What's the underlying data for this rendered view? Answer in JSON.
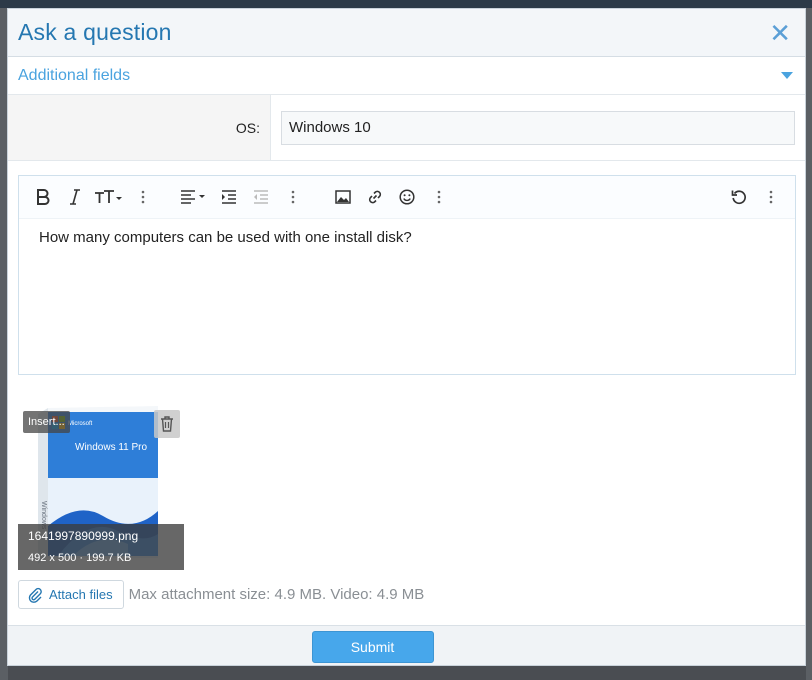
{
  "modal": {
    "title": "Ask a question",
    "close_glyph": "✕"
  },
  "additional_fields": {
    "title": "Additional fields"
  },
  "os_field": {
    "label": "OS:",
    "value": "Windows 10"
  },
  "editor": {
    "toolbar": [
      "bold-icon",
      "italic-icon",
      "text-size-icon",
      "more-icon",
      "align-icon",
      "indent-icon",
      "outdent-icon",
      "more-icon",
      "image-icon",
      "link-icon",
      "emoji-icon",
      "more-icon",
      "undo-icon",
      "more-icon"
    ],
    "content": "How many computers can be used with one install disk?"
  },
  "attachment": {
    "insert_label": "Insert...",
    "filename": "1641997890999.png",
    "meta": "492 x 500 · 199.7 KB",
    "box_text": "Windows 11 Pro",
    "box_side_text": "Windows",
    "brand_text": "Microsoft"
  },
  "attach": {
    "button_label": "Attach files",
    "hint": "Max attachment size: 4.9 MB. Video: 4.9 MB"
  },
  "footer": {
    "submit_label": "Submit"
  },
  "colors": {
    "accent": "#2577b1",
    "link": "#4aa3df",
    "submit": "#47a7eb"
  }
}
